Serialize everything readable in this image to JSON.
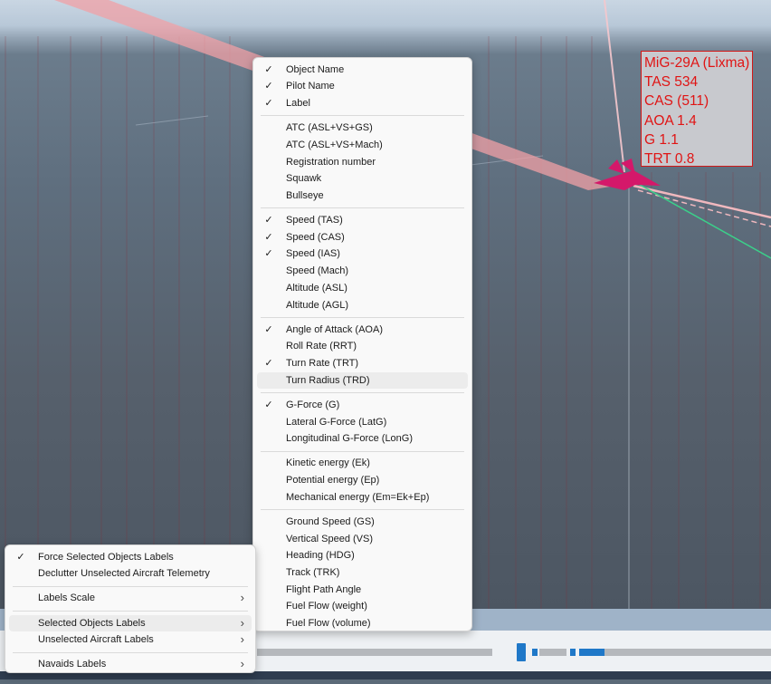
{
  "target_label": {
    "name": "MiG-29A (Lixma)",
    "lines": [
      "TAS 534",
      "CAS (511)",
      "AOA 1.4",
      "G 1.1",
      "TRT 0.8"
    ]
  },
  "labels_submenu": {
    "items": [
      {
        "label": "Object Name",
        "checked": true
      },
      {
        "label": "Pilot Name",
        "checked": true
      },
      {
        "label": "Label",
        "checked": true
      },
      {
        "sep": true
      },
      {
        "label": "ATC (ASL+VS+GS)",
        "checked": false
      },
      {
        "label": "ATC (ASL+VS+Mach)",
        "checked": false
      },
      {
        "label": "Registration number",
        "checked": false
      },
      {
        "label": "Squawk",
        "checked": false
      },
      {
        "label": "Bullseye",
        "checked": false
      },
      {
        "sep": true
      },
      {
        "label": "Speed (TAS)",
        "checked": true
      },
      {
        "label": "Speed (CAS)",
        "checked": true
      },
      {
        "label": "Speed (IAS)",
        "checked": true
      },
      {
        "label": "Speed (Mach)",
        "checked": false
      },
      {
        "label": "Altitude (ASL)",
        "checked": false
      },
      {
        "label": "Altitude (AGL)",
        "checked": false
      },
      {
        "sep": true
      },
      {
        "label": "Angle of Attack (AOA)",
        "checked": true
      },
      {
        "label": "Roll Rate (RRT)",
        "checked": false
      },
      {
        "label": "Turn Rate (TRT)",
        "checked": true
      },
      {
        "label": "Turn Radius (TRD)",
        "checked": false,
        "hover": true
      },
      {
        "sep": true
      },
      {
        "label": "G-Force (G)",
        "checked": true
      },
      {
        "label": "Lateral G-Force (LatG)",
        "checked": false
      },
      {
        "label": "Longitudinal G-Force (LonG)",
        "checked": false
      },
      {
        "sep": true
      },
      {
        "label": "Kinetic energy (Ek)",
        "checked": false
      },
      {
        "label": "Potential energy (Ep)",
        "checked": false
      },
      {
        "label": "Mechanical energy (Em=Ek+Ep)",
        "checked": false
      },
      {
        "sep": true
      },
      {
        "label": "Ground Speed (GS)",
        "checked": false
      },
      {
        "label": "Vertical Speed (VS)",
        "checked": false
      },
      {
        "label": "Heading (HDG)",
        "checked": false
      },
      {
        "label": "Track (TRK)",
        "checked": false
      },
      {
        "label": "Flight Path Angle",
        "checked": false
      },
      {
        "label": "Fuel Flow (weight)",
        "checked": false
      },
      {
        "label": "Fuel Flow (volume)",
        "checked": false
      }
    ]
  },
  "main_menu": {
    "items": [
      {
        "label": "Force Selected Objects Labels",
        "checked": true
      },
      {
        "label": "Declutter Unselected Aircraft Telemetry",
        "checked": false
      },
      {
        "sep": true
      },
      {
        "label": "Labels Scale",
        "submenu": true
      },
      {
        "sep": true
      },
      {
        "label": "Selected Objects Labels",
        "submenu": true,
        "hover": true
      },
      {
        "label": "Unselected Aircraft Labels",
        "submenu": true
      },
      {
        "sep": true
      },
      {
        "label": "Navaids Labels",
        "submenu": true
      }
    ]
  },
  "glyphs": {
    "check": "✓",
    "arrow": "›"
  }
}
